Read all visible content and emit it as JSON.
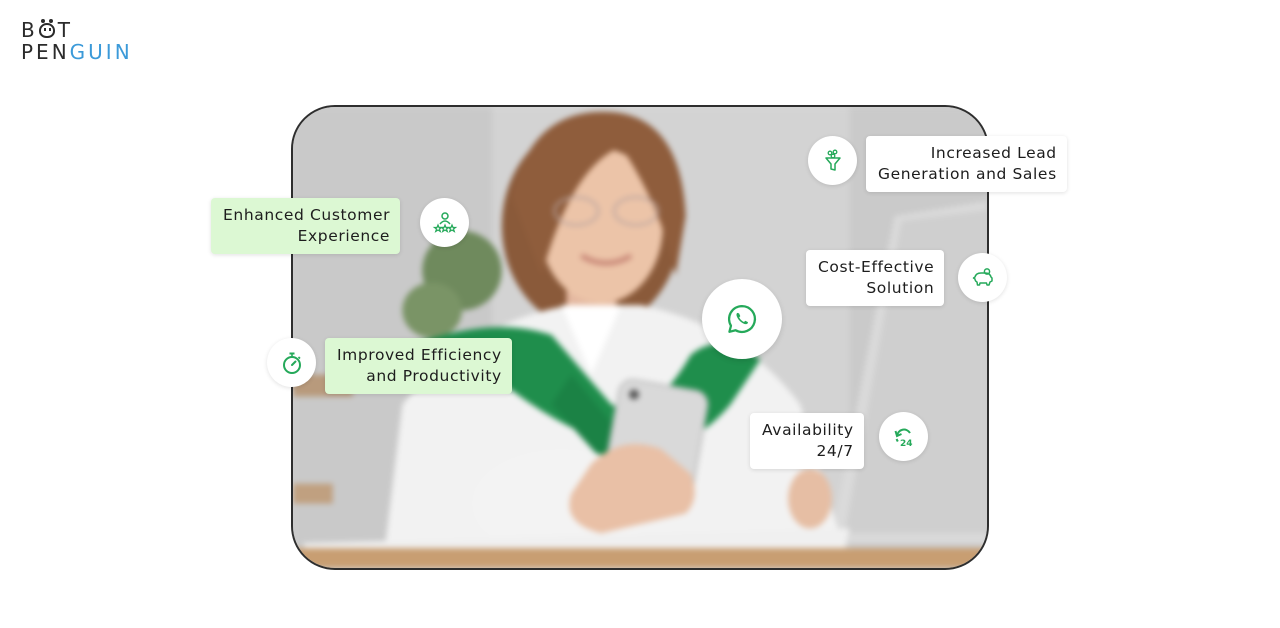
{
  "brand": {
    "line1_part1": "B",
    "line1_part2": "T",
    "line2_dark": "PEN",
    "line2_accent": "GUIN",
    "accent_color": "#3b9ad9",
    "dark_color": "#2b2b2b"
  },
  "hero": {
    "center_icon": "whatsapp-icon",
    "icon_color": "#25a95a"
  },
  "features": [
    {
      "id": "enhanced-customer-experience",
      "lines": [
        "Enhanced Customer",
        "Experience"
      ],
      "icon": "customer-rating-icon",
      "style": "green"
    },
    {
      "id": "increased-lead-generation",
      "lines": [
        "Increased Lead",
        "Generation and Sales"
      ],
      "icon": "funnel-icon",
      "style": "white"
    },
    {
      "id": "cost-effective-solution",
      "lines": [
        "Cost-Effective",
        "Solution"
      ],
      "icon": "piggy-bank-icon",
      "style": "white"
    },
    {
      "id": "improved-efficiency",
      "lines": [
        "Improved Efficiency",
        "and Productivity"
      ],
      "icon": "stopwatch-icon",
      "style": "green"
    },
    {
      "id": "availability-24-7",
      "lines": [
        "Availability",
        "24/7"
      ],
      "icon": "clock-24-icon",
      "style": "white"
    }
  ],
  "colors": {
    "green_card": "#dcf8d3",
    "white_card": "#ffffff",
    "frame_border": "#2e2e2e",
    "icon_green": "#25a95a"
  }
}
